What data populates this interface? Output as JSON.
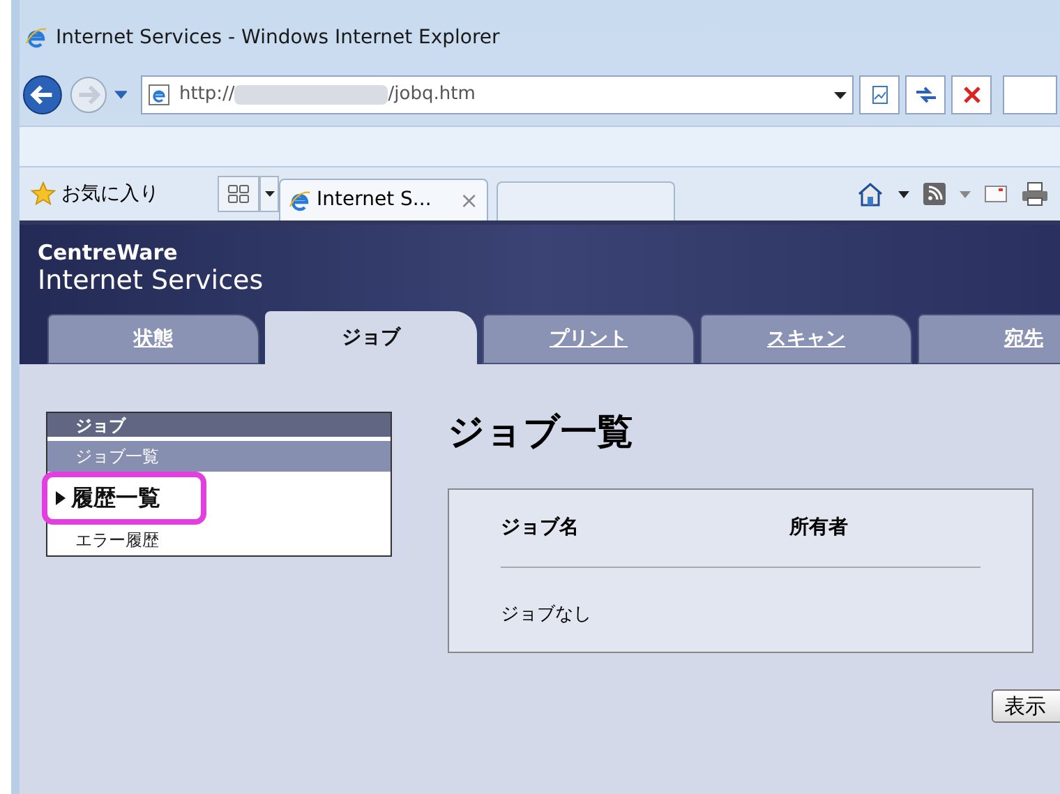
{
  "window": {
    "title": "Internet Services - Windows Internet Explorer"
  },
  "address_bar": {
    "url_start": "http://",
    "url_end": "/jobq.htm"
  },
  "favorites": {
    "label": "お気に入り"
  },
  "browser_tabs": [
    {
      "label": "Internet S...",
      "close": "×",
      "selected": true
    }
  ],
  "site": {
    "brand_line_1": "CentreWare",
    "brand_line_2": "Internet Services"
  },
  "nav_tabs": [
    {
      "label": "状態",
      "selected": false
    },
    {
      "label": "ジョブ",
      "selected": true
    },
    {
      "label": "プリント",
      "selected": false
    },
    {
      "label": "スキャン",
      "selected": false
    },
    {
      "label": "宛先",
      "selected": false
    }
  ],
  "sidebar": {
    "heading": "ジョブ",
    "items": [
      {
        "label": "ジョブ一覧",
        "selected": true,
        "callout": false
      },
      {
        "label": "履歴一覧",
        "selected": false,
        "callout": true
      },
      {
        "label": "エラー履歴",
        "selected": false,
        "callout": false
      }
    ]
  },
  "main": {
    "title": "ジョブ一覧",
    "columns": [
      "ジョブ名",
      "所有者"
    ],
    "empty_text": "ジョブなし",
    "button": "表示"
  }
}
